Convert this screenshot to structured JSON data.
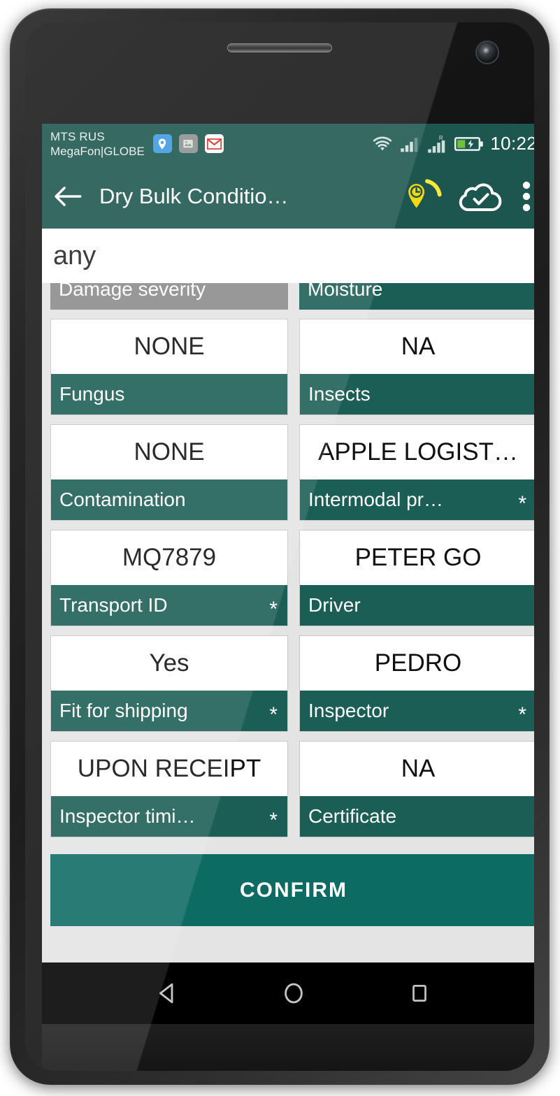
{
  "status_bar": {
    "carrier_line1": "MTS RUS",
    "carrier_line2": "MegaFon|GLOBE",
    "tray_icons": [
      "maps-pin-icon",
      "screenshot-image-icon",
      "gmail-icon"
    ],
    "wifi": "wifi-icon",
    "signal_1": "cellular-signal-icon",
    "signal_2": "cellular-signal-roaming-icon",
    "roaming_badge": "R",
    "battery": "battery-charging-icon",
    "clock": "10:22"
  },
  "app_bar": {
    "back": "back-arrow-icon",
    "title": "Dry Bulk Conditio…",
    "gps_icon": "location-clock-icon",
    "cloud_icon": "cloud-check-icon",
    "overflow_icon": "more-vertical-icon"
  },
  "value_strip": {
    "text": "any"
  },
  "colors": {
    "teal_primary": "#1d564f",
    "teal_label": "#1b5e55",
    "teal_confirm": "#0c6b63",
    "disabled_gray": "#8b8b8b",
    "screen_bg": "#e4e4e4",
    "accent_yellow": "#f7d910"
  },
  "fields": {
    "clipped_row": [
      {
        "label": "Damage severity",
        "required": false,
        "disabled": true
      },
      {
        "label": "Moisture",
        "required": false,
        "disabled": false
      }
    ],
    "rows": [
      [
        {
          "value": "NONE",
          "label": "Fungus",
          "required": false,
          "disabled": false
        },
        {
          "value": "NA",
          "label": "Insects",
          "required": false,
          "disabled": false
        }
      ],
      [
        {
          "value": "NONE",
          "label": "Contamination",
          "required": false,
          "disabled": false
        },
        {
          "value": "APPLE LOGIST…",
          "label": "Intermodal pr…",
          "required": true,
          "disabled": false
        }
      ],
      [
        {
          "value": "MQ7879",
          "label": "Transport ID",
          "required": true,
          "disabled": false
        },
        {
          "value": "PETER GO",
          "label": "Driver",
          "required": false,
          "disabled": false
        }
      ],
      [
        {
          "value": "Yes",
          "label": "Fit for shipping",
          "required": true,
          "disabled": false
        },
        {
          "value": "PEDRO",
          "label": "Inspector",
          "required": true,
          "disabled": false
        }
      ],
      [
        {
          "value": "UPON RECEIPT",
          "label": "Inspector timi…",
          "required": true,
          "disabled": false
        },
        {
          "value": "NA",
          "label": "Certificate",
          "required": false,
          "disabled": false
        }
      ]
    ]
  },
  "confirm": {
    "label": "CONFIRM"
  },
  "nav_bar": {
    "back": "nav-back-triangle-icon",
    "home": "nav-home-circle-icon",
    "recents": "nav-recents-square-icon"
  },
  "required_marker": "*"
}
